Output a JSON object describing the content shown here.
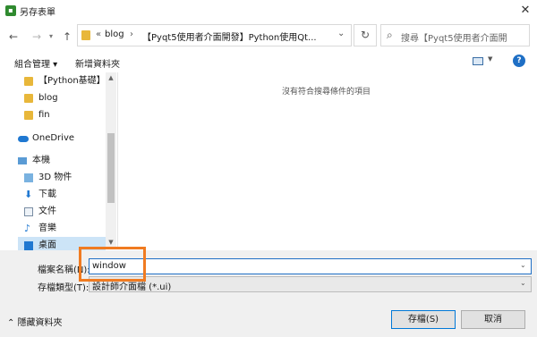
{
  "window": {
    "title": "另存表單",
    "close_label": "✕"
  },
  "icons": {
    "app": "app-icon",
    "folder": "folder-icon",
    "onedrive": "cloud-icon"
  },
  "address": {
    "chevron": "«",
    "part1": "blog",
    "separator": "›",
    "part2": "【Pyqt5使用者介面開發】Python使用Qt...",
    "dropdown": "⌄"
  },
  "search": {
    "placeholder": "搜尋【Pyqt5使用者介面開"
  },
  "commandbar": {
    "organize": "組合管理 ▾",
    "new_folder": "新增資料夾",
    "help": "?"
  },
  "nav": {
    "items": [
      {
        "label": "【Python基礎】看"
      },
      {
        "label": "blog"
      },
      {
        "label": "fin"
      },
      {
        "label": "OneDrive"
      },
      {
        "label": "本機"
      },
      {
        "label": "3D 物件"
      },
      {
        "label": "下載"
      },
      {
        "label": "文件"
      },
      {
        "label": "音樂"
      },
      {
        "label": "桌面"
      }
    ]
  },
  "content": {
    "empty_message": "沒有符合搜尋條件的項目"
  },
  "form": {
    "filename_label": "檔案名稱(N):",
    "filename_value": "window",
    "filetype_label": "存檔類型(T):",
    "filetype_value": "設計師介面檔 (*.ui)"
  },
  "footer": {
    "hide_folders": "⌃ 隱藏資料夾",
    "save": "存檔(S)",
    "cancel": "取消"
  },
  "colors": {
    "accent": "#0078d7",
    "highlight": "#f07b21",
    "folder": "#e8b73a"
  }
}
